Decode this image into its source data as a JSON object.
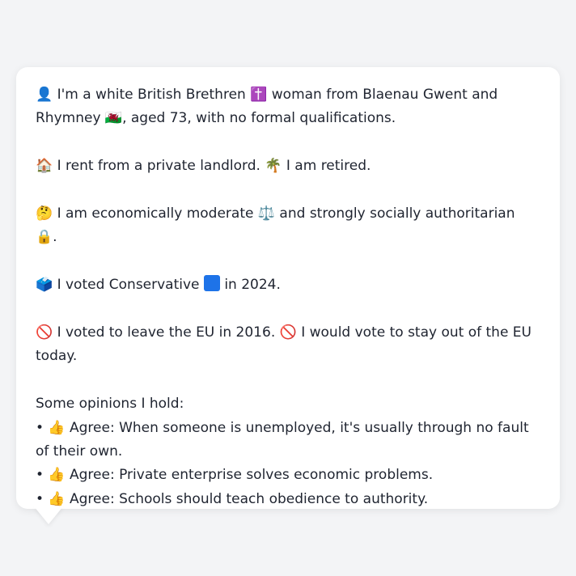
{
  "profile": {
    "p1": "👤 I'm a white British Brethren ✝️ woman from Blaenau Gwent and Rhymney 🏴󠁧󠁢󠁷󠁬󠁳󠁿, aged 73, with no formal qualifications.",
    "p2": "🏠 I rent from a private landlord. 🌴 I am retired.",
    "p3": "🤔 I am economically moderate ⚖️ and strongly socially authoritarian 🔒.",
    "p4a": "🗳️ I voted Conservative",
    "p4b": "in 2024.",
    "p5": "🚫 I voted to leave the EU in 2016. 🚫 I would vote to stay out of the EU today."
  },
  "opinions": {
    "heading": "Some opinions I hold:",
    "items": [
      "• 👍 Agree: When someone is unemployed, it's usually through no fault of their own.",
      "• 👍 Agree: Private enterprise solves economic problems.",
      "• 👍 Agree: Schools should teach obedience to authority."
    ]
  },
  "colors": {
    "party_square": "#1e73e8",
    "bubble_bg": "#ffffff",
    "page_bg": "#f3f4f6"
  }
}
